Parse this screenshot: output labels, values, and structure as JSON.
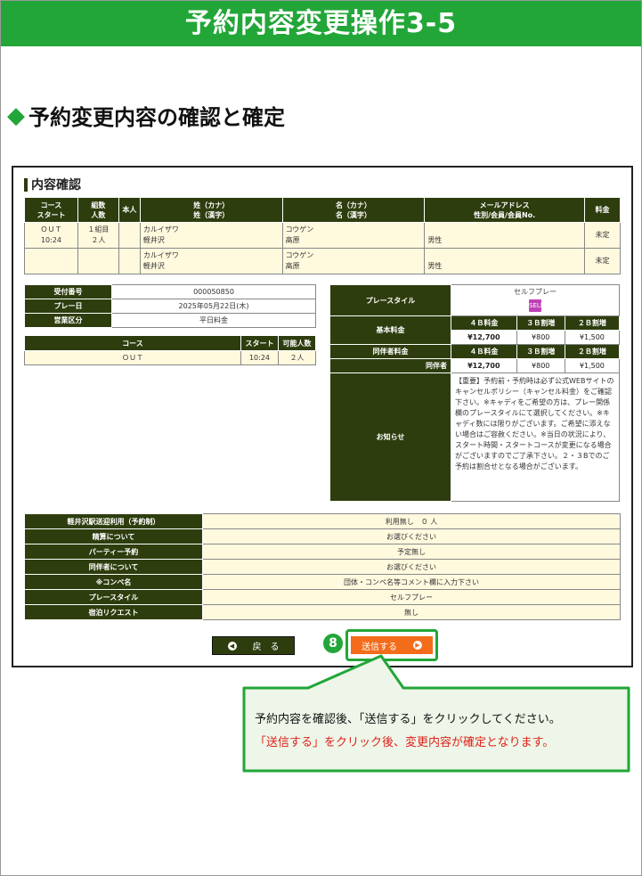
{
  "page": {
    "title": "予約内容変更操作3-5",
    "section_heading": "予約変更内容の確認と確定"
  },
  "screen": {
    "heading": "内容確認",
    "reservation_table": {
      "headers": [
        "コース\nスタート",
        "組数\n人数",
        "本人",
        "姓（カナ）\n姓（漢字）",
        "名（カナ）\n名（漢字）",
        "メールアドレス\n性別/会員/会員No.",
        "料金"
      ],
      "rows": [
        {
          "course": "ＯＵＴ",
          "start": "10:24",
          "group": "１組目",
          "people": "２人",
          "self": "",
          "sei_kana": "カルイザワ",
          "sei_kanji": "軽井沢",
          "mei_kana": "コウゲン",
          "mei_kanji": "高原",
          "email": "",
          "gender": "男性",
          "fee": "未定"
        },
        {
          "course": "",
          "start": "",
          "group": "",
          "people": "",
          "self": "",
          "sei_kana": "カルイザワ",
          "sei_kanji": "軽井沢",
          "mei_kana": "コウゲン",
          "mei_kanji": "高原",
          "email": "",
          "gender": "男性",
          "fee": "未定"
        }
      ]
    },
    "info": {
      "receipt_no_label": "受付番号",
      "receipt_no": "000050850",
      "play_date_label": "プレー日",
      "play_date": "2025年05月22日(木)",
      "business_label": "営業区分",
      "business": "平日料金"
    },
    "course_table": {
      "headers": [
        "コース",
        "スタート",
        "可能人数"
      ],
      "row": {
        "course": "ＯＵＴ",
        "start": "10:24",
        "capacity": "２人"
      }
    },
    "price": {
      "play_style_label": "プレースタイル",
      "play_style": "セルフプレー",
      "self_icon_text": "SELF",
      "base_label": "基本料金",
      "companion_label": "同伴者料金",
      "companion_sub": "同伴者",
      "cols": [
        "４Ｂ料金",
        "３Ｂ割増",
        "２Ｂ割増"
      ],
      "base_values": [
        "¥12,700",
        "¥800",
        "¥1,500"
      ],
      "companion_values": [
        "¥12,700",
        "¥800",
        "¥1,500"
      ],
      "notice_label": "お知らせ",
      "notice_text": "【重要】予約前・予約時は必ず公式WEBサイトのキャンセルポリシー（キャンセル料金）をご確認下さい。※キャディをご希望の方は、プレー関係欄のプレースタイルにて選択してください。※キャディ数には限りがございます。ご希望に添えない場合はご容赦ください。※当日の状況により、スタート時間・スタートコースが変更になる場合がございますのでご了承下さい。２・３Bでのご予約は割合せとなる場合がございます。"
    },
    "options": [
      {
        "label": "軽井沢駅送迎利用（予約制）",
        "value": "利用無し　０ 人"
      },
      {
        "label": "精算について",
        "value": "お選びください"
      },
      {
        "label": "パーティー予約",
        "value": "予定無し"
      },
      {
        "label": "同伴者について",
        "value": "お選びください"
      },
      {
        "label": "※コンペ名",
        "value": "団体・コンペ名等コメント欄に入力下さい"
      },
      {
        "label": "プレースタイル",
        "value": "セルフプレー"
      },
      {
        "label": "宿泊リクエスト",
        "value": "無し"
      }
    ],
    "back_button": "戻　る",
    "send_button": "送信する",
    "step_number": "8"
  },
  "callout": {
    "line1": "予約内容を確認後、「送信する」をクリックしてください。",
    "line2": "「送信する」をクリック後、変更内容が確定となります。"
  },
  "colors": {
    "accent": "#22a638",
    "header_dark": "#2e3d0e",
    "cell_bg": "#fff9de",
    "send": "#f26c1a",
    "warn": "#e0201a"
  }
}
